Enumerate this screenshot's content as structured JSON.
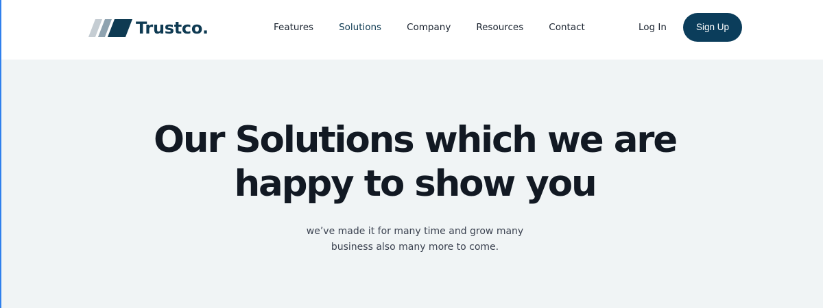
{
  "brand": {
    "name": "Trustco.",
    "logo_icon": "striped-parallelogram-logo",
    "colors": {
      "primary": "#0b3d5b",
      "hero_background": "#f0f4f5",
      "heading_text": "#121923"
    }
  },
  "nav": {
    "items": [
      {
        "label": "Features",
        "active": false
      },
      {
        "label": "Solutions",
        "active": true
      },
      {
        "label": "Company",
        "active": false
      },
      {
        "label": "Resources",
        "active": false
      },
      {
        "label": "Contact",
        "active": false
      }
    ]
  },
  "auth": {
    "login_label": "Log In",
    "signup_label": "Sign Up"
  },
  "hero": {
    "title_line1": "Our Solutions which we are",
    "title_line2": "happy to show you",
    "subtitle_line1": "we’ve made it for many time and grow many",
    "subtitle_line2": "business also many more to come."
  }
}
